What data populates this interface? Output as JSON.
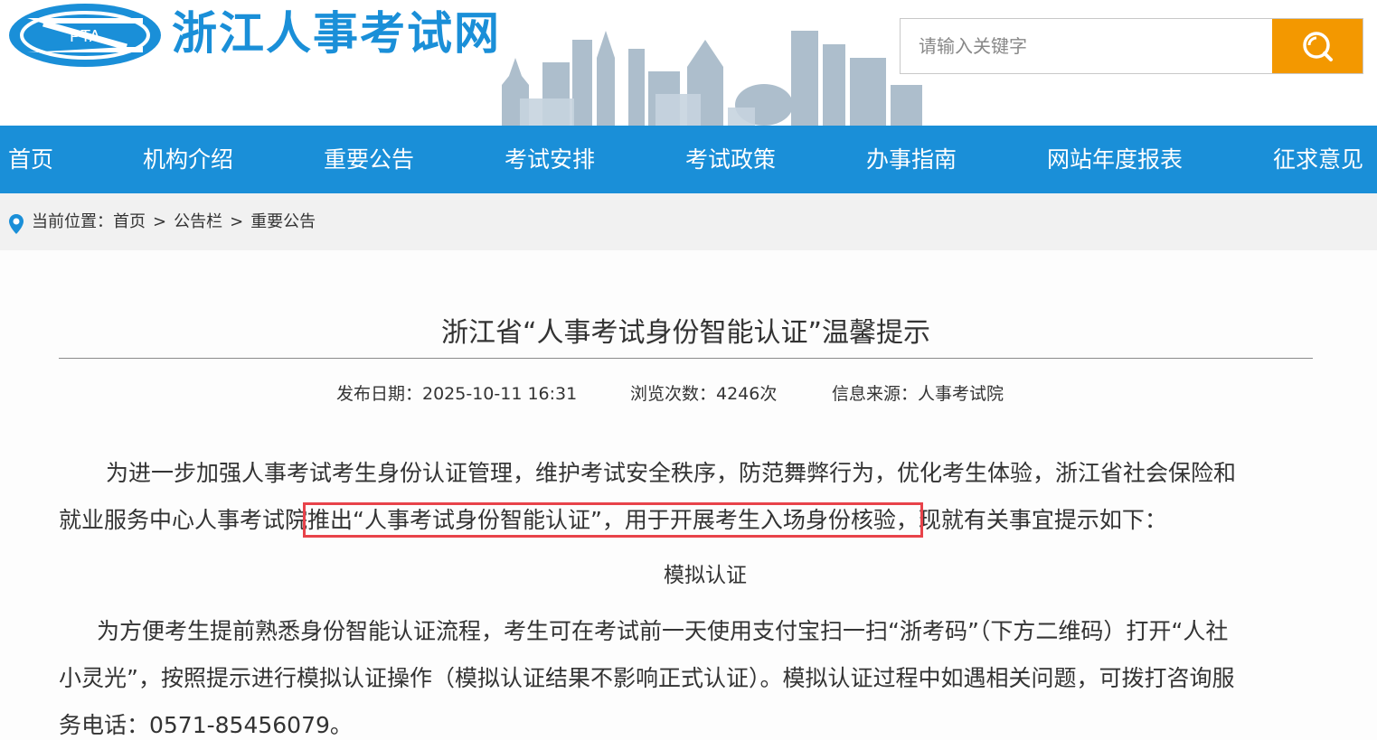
{
  "header": {
    "logo_text": "PTA",
    "site_title": "浙江人事考试网",
    "search": {
      "placeholder": "请输入关键字",
      "value": ""
    },
    "search_icon": "search-icon",
    "colors": {
      "brand_blue": "#1a8fd8",
      "search_orange": "#f39800"
    }
  },
  "nav": {
    "items": [
      {
        "label": "首页"
      },
      {
        "label": "机构介绍"
      },
      {
        "label": "重要公告"
      },
      {
        "label": "考试安排"
      },
      {
        "label": "考试政策"
      },
      {
        "label": "办事指南"
      },
      {
        "label": "网站年度报表"
      },
      {
        "label": "征求意见"
      }
    ]
  },
  "breadcrumb": {
    "icon": "location-pin-icon",
    "prefix": "当前位置：",
    "items": [
      "首页",
      "公告栏",
      "重要公告"
    ],
    "separator": ">"
  },
  "article": {
    "title": "浙江省“人事考试身份智能认证”温馨提示",
    "publish_date": "发布日期：2025-10-11 16:31",
    "views": "浏览次数：4246次",
    "source": "信息来源：人事考试院",
    "p1_line1": "为进一步加强人事考试考生身份认证管理，维护考试安全秩序，防范舞弊行为，优化考生体验，浙江省社会保险和",
    "p1_line2_a": "就业服务中心人事考试院",
    "p1_line2_highlight": "推出“人事考试身份智能认证”，用于开展考生入场身份核验，",
    "p1_line2_b": "现就有关事宜提示如下：",
    "subheading": "模拟认证",
    "p2_line1": "为方便考生提前熟悉身份智能认证流程，考生可在考试前一天使用支付宝扫一扫“浙考码”（下方二维码）打开“人社",
    "p2_line2": "小灵光”，按照提示进行模拟认证操作（模拟认证结果不影响正式认证）。模拟认证过程中如遇相关问题，可拨打咨询服",
    "p2_line3": "务电话：0571-85456079。",
    "highlight_color": "#e8434a"
  }
}
